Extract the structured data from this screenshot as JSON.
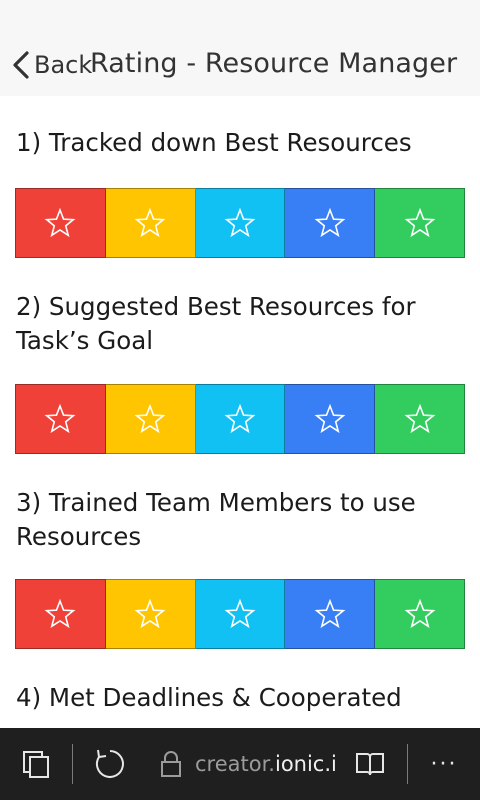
{
  "header": {
    "back_label": "Back",
    "title": "Rating - Resource Manager"
  },
  "questions": [
    {
      "text": "1) Tracked down Best Resources"
    },
    {
      "text": "2) Suggested Best Resources for Task’s Goal"
    },
    {
      "text": "3) Trained Team Members to use Resources"
    },
    {
      "text": "4) Met Deadlines & Cooperated"
    }
  ],
  "rating_colors": [
    "#f04139",
    "#ffc500",
    "#11c1f3",
    "#387ef5",
    "#33cd5f"
  ],
  "rating_icon": "star-outline-icon",
  "star_glyph": "☆",
  "browser_bar": {
    "url_prefix": "creator.",
    "url_domain": "ionic.io",
    "more_label": "···",
    "icons": [
      "tabs-icon",
      "refresh-icon",
      "lock-icon",
      "reading-view-icon",
      "more-icon"
    ]
  }
}
